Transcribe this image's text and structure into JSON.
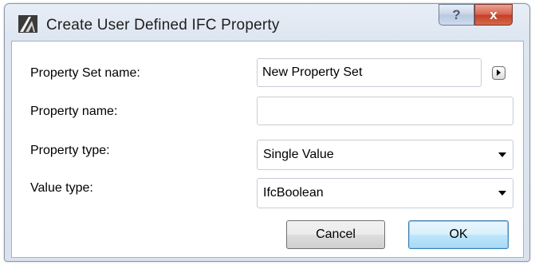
{
  "window": {
    "title": "Create User Defined IFC Property",
    "help_label": "?",
    "close_label": "x"
  },
  "form": {
    "property_set_name": {
      "label": "Property Set name:",
      "value": "New Property Set"
    },
    "property_name": {
      "label": "Property name:",
      "value": ""
    },
    "property_type": {
      "label": "Property type:",
      "value": "Single Value"
    },
    "value_type": {
      "label": "Value type:",
      "value": "IfcBoolean"
    }
  },
  "buttons": {
    "cancel_label": "Cancel",
    "ok_label": "OK"
  },
  "colors": {
    "close_button": "#c94a30",
    "ok_button_border": "#3c7fb1"
  }
}
